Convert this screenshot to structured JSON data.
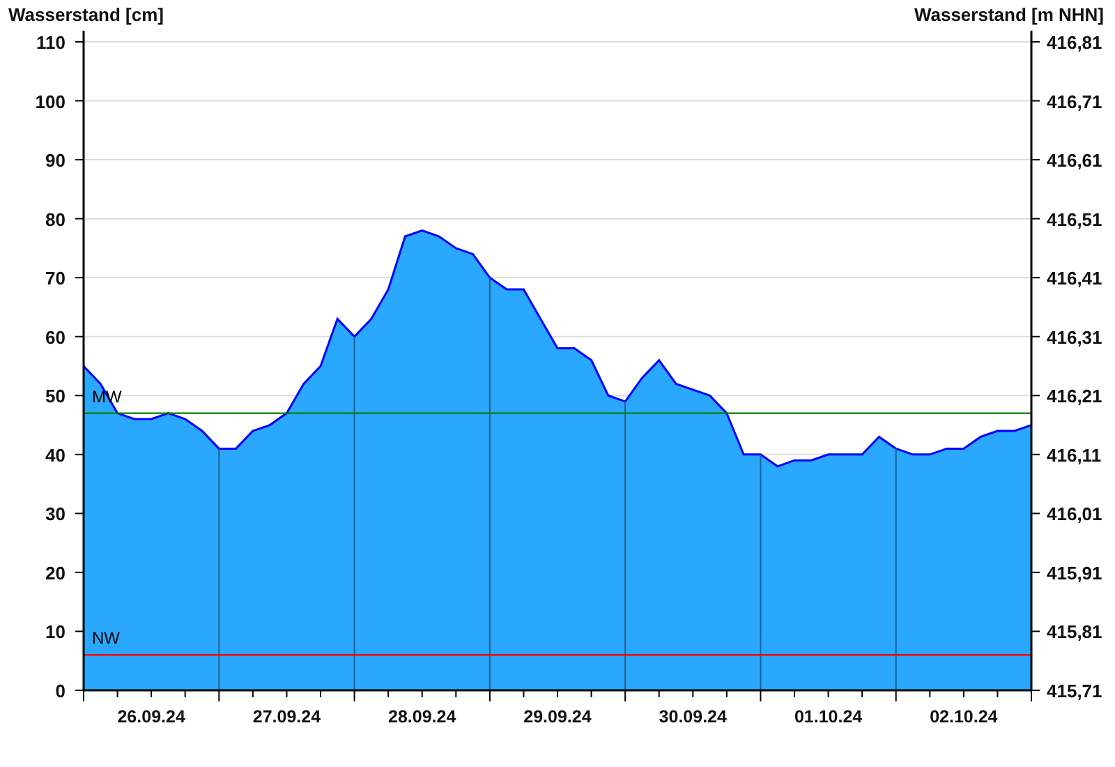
{
  "chart_data": {
    "type": "area",
    "ylabel": "Wasserstand [cm]",
    "grid": true,
    "categories": [
      null,
      null,
      null,
      null,
      "26.09.24",
      null,
      null,
      null,
      null,
      null,
      null,
      null,
      "27.09.24",
      null,
      null,
      null,
      null,
      null,
      null,
      null,
      "28.09.24",
      null,
      null,
      null,
      null,
      null,
      null,
      null,
      "29.09.24",
      null,
      null,
      null,
      null,
      null,
      null,
      null,
      "30.09.24",
      null,
      null,
      null,
      null,
      null,
      null,
      null,
      "01.10.24",
      null,
      null,
      null,
      null,
      null,
      null,
      null,
      "02.10.24",
      null,
      null,
      null,
      null
    ],
    "series": [
      {
        "color": "#2aa8ff",
        "values": [
          55,
          52,
          47,
          46,
          46,
          47,
          46,
          44,
          41,
          41,
          44,
          45,
          47,
          52,
          55,
          63,
          60,
          63,
          68,
          77,
          78,
          77,
          75,
          74,
          70,
          68,
          68,
          63,
          58,
          58,
          56,
          50,
          49,
          53,
          56,
          52,
          51,
          50,
          47,
          40,
          40,
          38,
          39,
          39,
          40,
          40,
          40,
          43,
          41,
          40,
          40,
          41,
          41,
          43,
          44,
          44,
          45
        ]
      }
    ],
    "ylim": [
      0,
      110
    ],
    "yticks": [
      0,
      10,
      20,
      30,
      40,
      50,
      60,
      70,
      80,
      90,
      100,
      110
    ],
    "ref_lines": [
      {
        "axis": "y",
        "value": 47,
        "label": "MW",
        "color": "#008000"
      },
      {
        "axis": "y",
        "value": 6,
        "label": "NW",
        "color": "#ff0000"
      }
    ]
  },
  "right_axis": {
    "title": "Wasserstand [m NHN]",
    "tick_labels": [
      "416,81",
      "416,71",
      "416,61",
      "416,51",
      "416,41",
      "416,31",
      "416,21",
      "416,11",
      "416,01",
      "415,91",
      "415,81",
      "415,71"
    ]
  }
}
